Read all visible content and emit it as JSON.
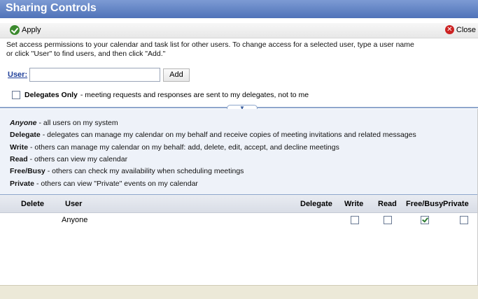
{
  "window": {
    "title": "Sharing Controls"
  },
  "toolbar": {
    "apply_label": "Apply",
    "apply_icon": "checkmark-icon",
    "close_label": "Close",
    "close_icon": "close-icon"
  },
  "intro": {
    "line1": "Set access permissions to your calendar and task list for other users. To change access for a selected user, type a user name",
    "line2": "or click \"User\" to find users, and then click \"Add.\""
  },
  "user_field": {
    "label": "User:",
    "value": "",
    "add_label": "Add"
  },
  "delegates": {
    "checked": false,
    "label": "Delegates Only",
    "description": "- meeting requests and responses are sent to my delegates, not to me"
  },
  "legend": [
    {
      "term": "Anyone",
      "desc": "- all users on my system"
    },
    {
      "term": "Delegate",
      "desc": "- delegates can manage my calendar on my behalf and receive copies of meeting invitations and related messages"
    },
    {
      "term": "Write",
      "desc": "- others can manage my calendar on my behalf: add, delete, edit, accept, and decline meetings"
    },
    {
      "term": "Read",
      "desc": "- others can view my calendar"
    },
    {
      "term": "Free/Busy",
      "desc": "- others can check my availability when scheduling meetings"
    },
    {
      "term": "Private",
      "desc": "- others can view \"Private\" events on my calendar"
    }
  ],
  "table": {
    "headers": {
      "delete": "Delete",
      "user": "User",
      "delegate": "Delegate",
      "write": "Write",
      "read": "Read",
      "freebusy": "Free/Busy",
      "private": "Private"
    },
    "rows": [
      {
        "user": "Anyone",
        "write": false,
        "read": false,
        "freebusy": true,
        "private": false
      }
    ]
  }
}
